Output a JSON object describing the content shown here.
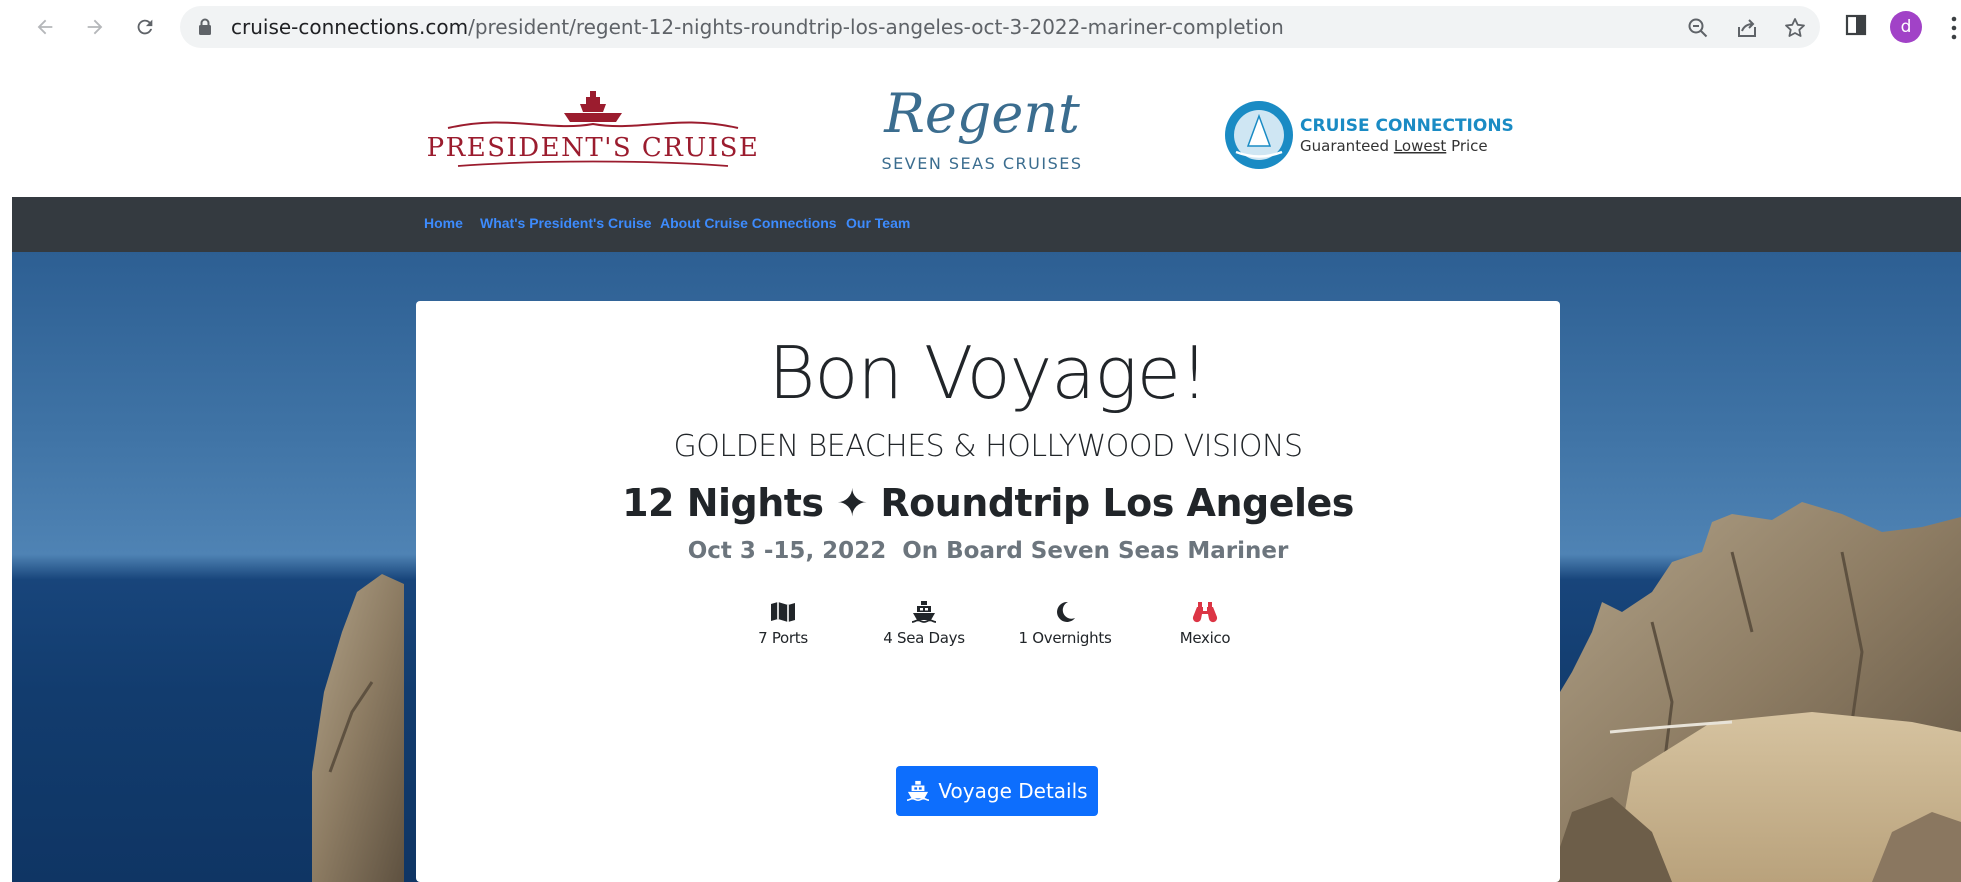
{
  "browser": {
    "url_host": "cruise-connections.com",
    "url_path": "/president/regent-12-nights-roundtrip-los-angeles-oct-3-2022-mariner-completion",
    "profile_initial": "d"
  },
  "logos": {
    "presidents": "PRESIDENT'S CRUISE",
    "regent_script": "Regent",
    "regent_sub": "SEVEN SEAS CRUISES",
    "cc_name": "CRUISE CONNECTIONS",
    "cc_tag_pre": "Guaranteed ",
    "cc_tag_em": "Lowest",
    "cc_tag_post": " Price"
  },
  "nav": {
    "items": [
      {
        "label": "Home"
      },
      {
        "label": "What's President's Cruise"
      },
      {
        "label": "About Cruise Connections"
      },
      {
        "label": "Our Team"
      }
    ]
  },
  "card": {
    "title": "Bon Voyage!",
    "subtitle": "GOLDEN BEACHES & HOLLYWOOD VISIONS",
    "headline": "12 Nights ✦ Roundtrip Los Angeles",
    "dates": "Oct 3 -15, 2022  On Board Seven Seas Mariner",
    "stats": [
      {
        "label": "7 Ports",
        "icon": "map-icon"
      },
      {
        "label": "4 Sea Days",
        "icon": "ship-icon"
      },
      {
        "label": "1 Overnights",
        "icon": "moon-icon"
      },
      {
        "label": "Mexico",
        "icon": "binoculars-icon"
      }
    ],
    "button_label": "Voyage Details"
  },
  "colors": {
    "nav_bg": "#343a40",
    "nav_link": "#3d8bfd",
    "button": "#0d6efd",
    "brand_red": "#9b1c2e",
    "regent_blue": "#3b6d8f",
    "cc_blue": "#1a8bc4",
    "accent_red": "#dc3545"
  }
}
